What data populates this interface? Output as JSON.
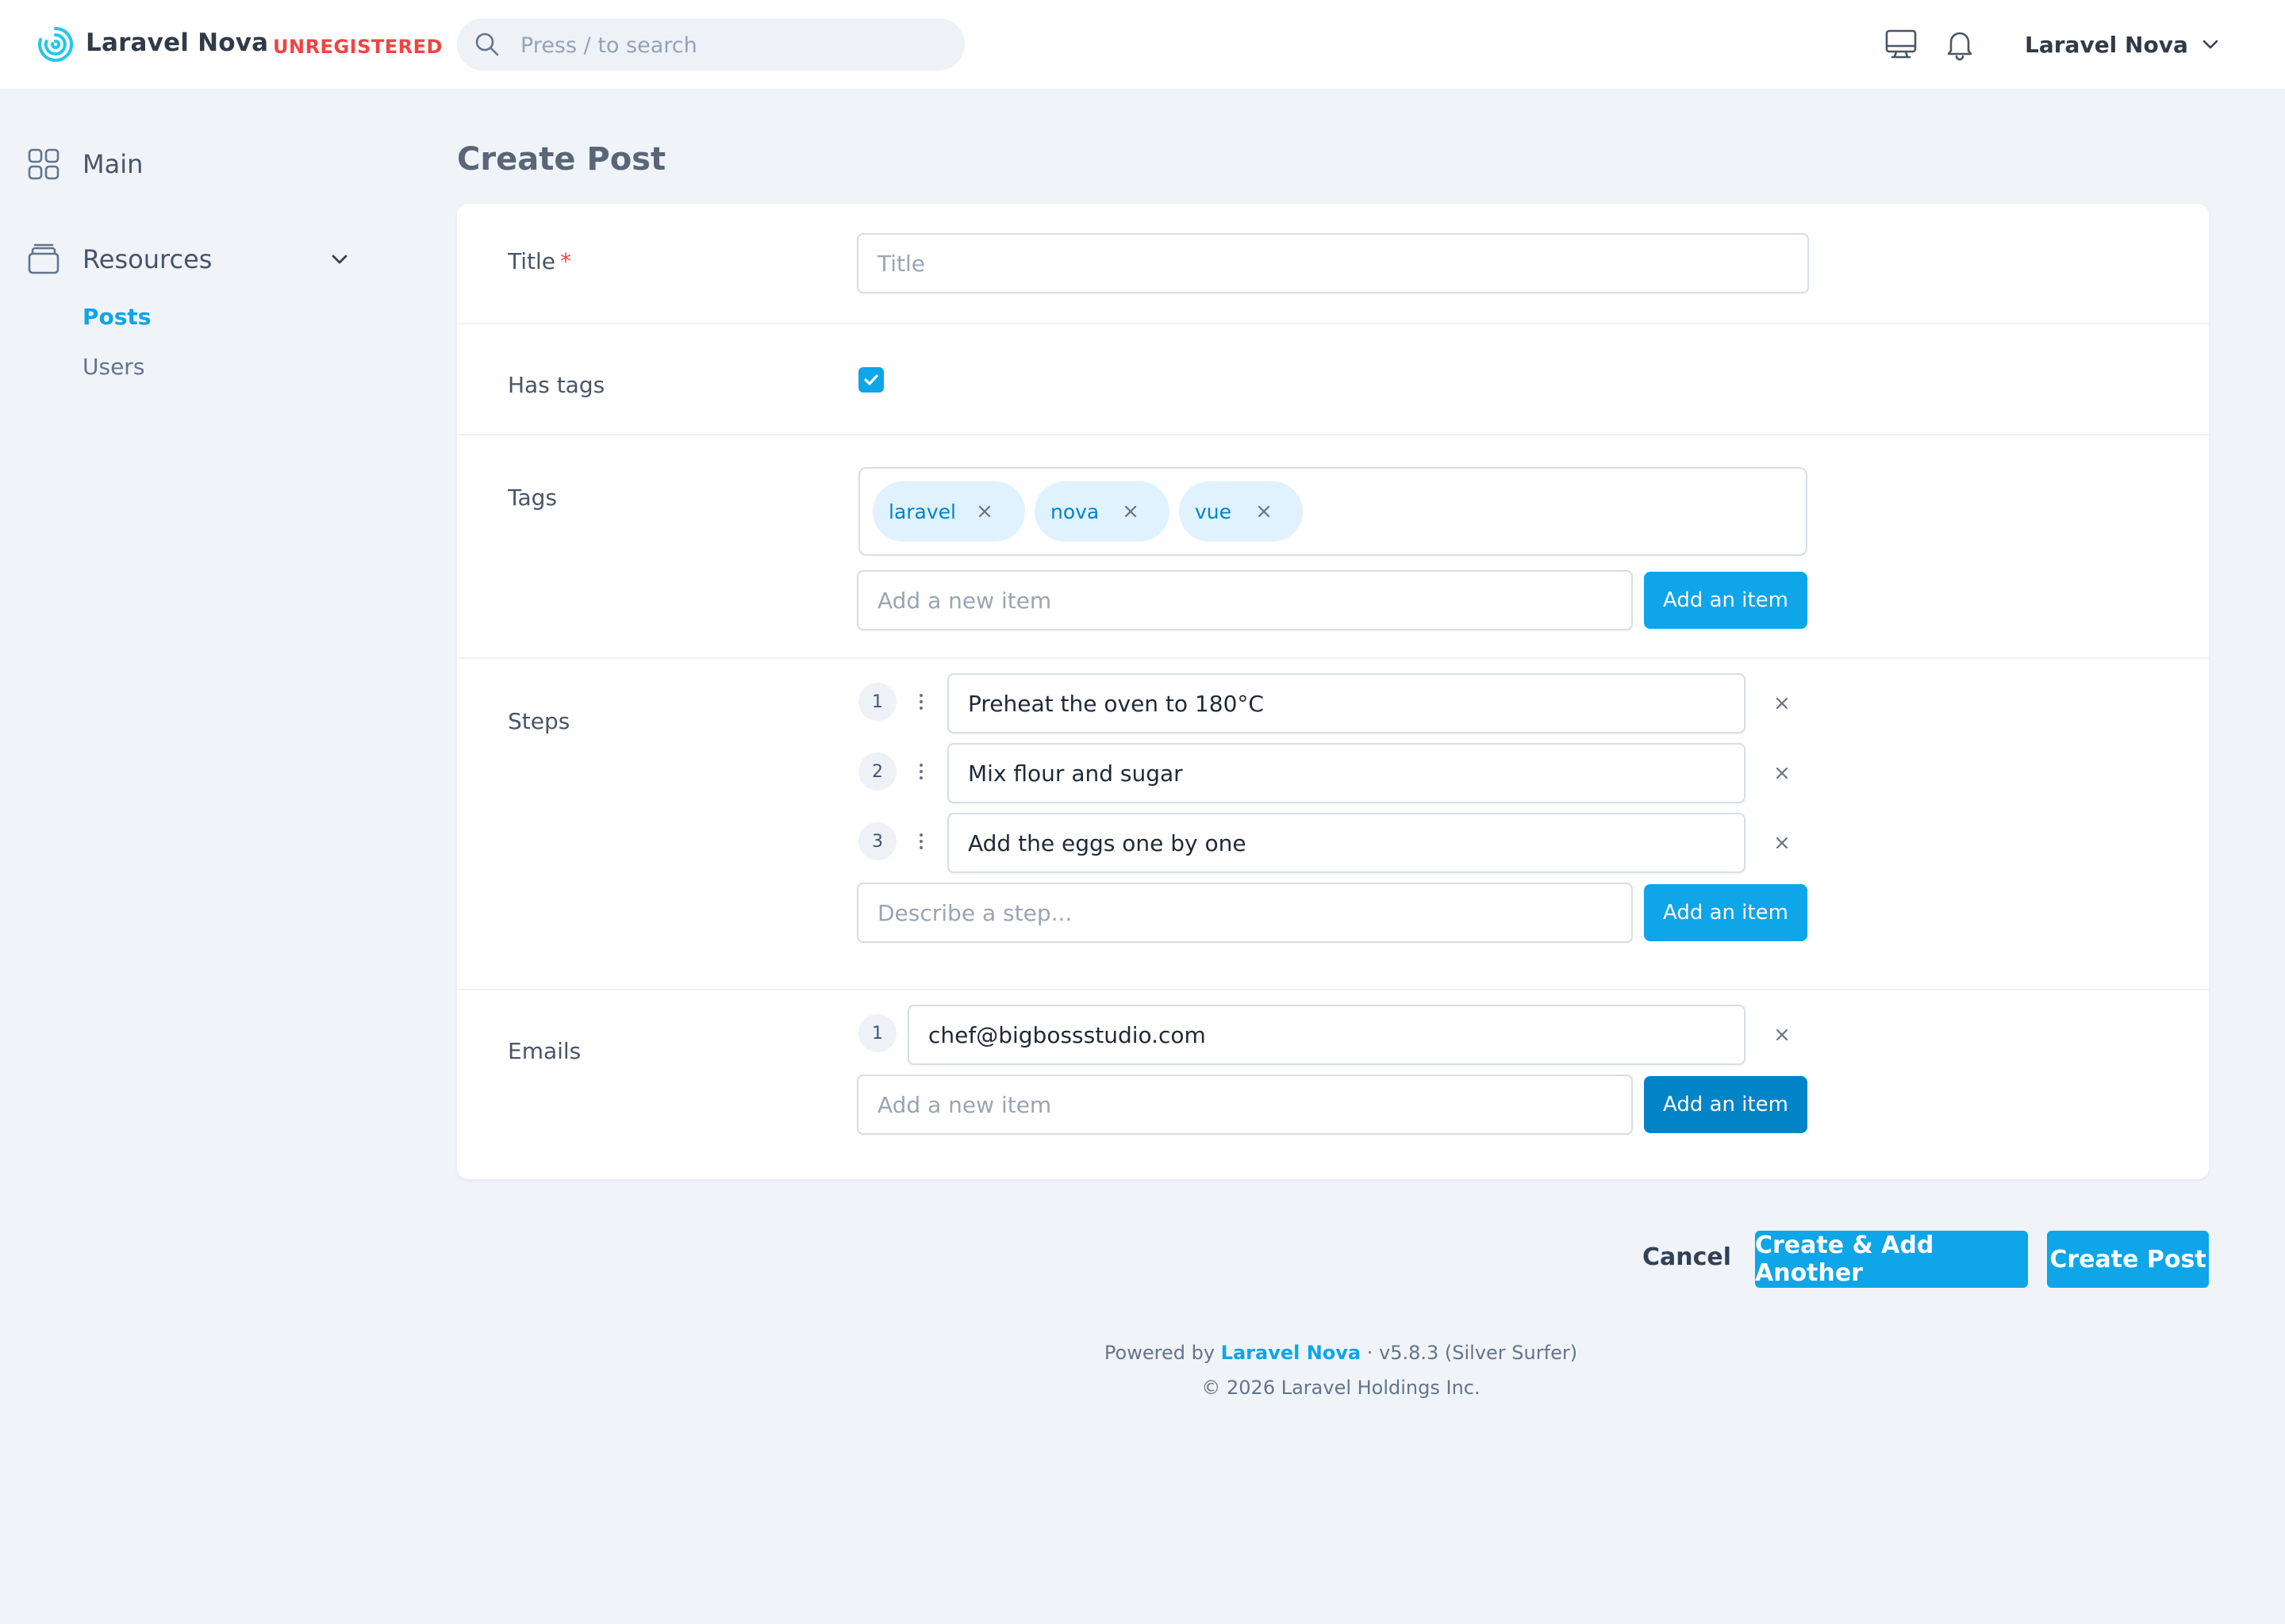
{
  "header": {
    "brand": "Laravel Nova",
    "license_badge": "UNREGISTERED",
    "search_placeholder": "Press / to search",
    "user_name": "Laravel Nova"
  },
  "sidebar": {
    "main_label": "Main",
    "resources_label": "Resources",
    "items": [
      {
        "label": "Posts",
        "active": true
      },
      {
        "label": "Users",
        "active": false
      }
    ]
  },
  "page": {
    "title": "Create Post"
  },
  "form": {
    "title_field": {
      "label": "Title",
      "required_mark": "*",
      "placeholder": "Title",
      "value": ""
    },
    "has_tags_field": {
      "label": "Has tags",
      "checked": true
    },
    "tags_field": {
      "label": "Tags",
      "tags": [
        "laravel",
        "nova",
        "vue"
      ],
      "new_item_placeholder": "Add a new item",
      "add_button": "Add an item"
    },
    "steps_field": {
      "label": "Steps",
      "steps": [
        {
          "number": "1",
          "text": "Preheat the oven to 180°C"
        },
        {
          "number": "2",
          "text": "Mix flour and sugar"
        },
        {
          "number": "3",
          "text": "Add the eggs one by one"
        }
      ],
      "new_item_placeholder": "Describe a step...",
      "add_button": "Add an item"
    },
    "emails_field": {
      "label": "Emails",
      "emails": [
        {
          "number": "1",
          "text": "chef@bigbossstudio.com"
        }
      ],
      "new_item_placeholder": "Add a new item",
      "add_button": "Add an item"
    }
  },
  "actions": {
    "cancel": "Cancel",
    "create_another": "Create & Add Another",
    "create": "Create Post"
  },
  "footer": {
    "powered_prefix": "Powered by",
    "powered_link": "Laravel Nova",
    "version": "· v5.8.3 (Silver Surfer)",
    "copyright": "© 2026 Laravel Holdings Inc."
  },
  "colors": {
    "accent": "#0ea5e9",
    "accent_dark": "#0284c7",
    "danger": "#ef4444",
    "background": "#f0f4f9"
  }
}
